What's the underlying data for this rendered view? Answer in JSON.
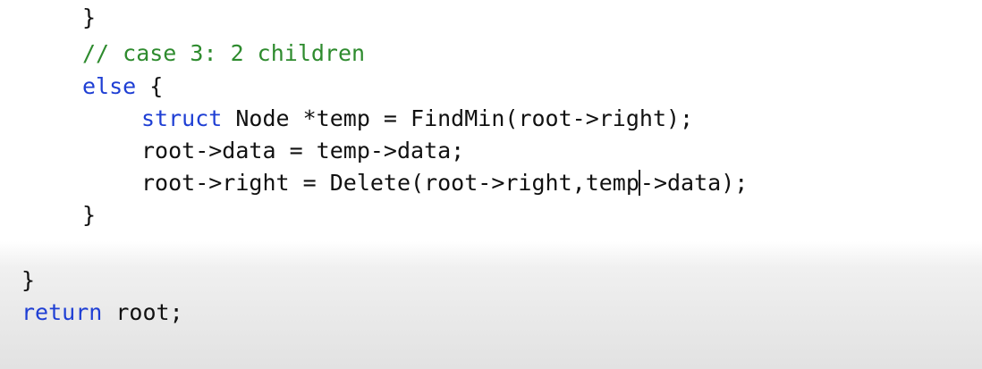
{
  "editor": {
    "lines": [
      {
        "id": "close-case2",
        "text": "}"
      },
      {
        "id": "comment-case3",
        "text": "// case 3: 2 children"
      },
      {
        "id": "else-line",
        "keyword": "else",
        "rest": " {"
      },
      {
        "id": "struct-line",
        "keyword": "struct",
        "rest": " Node *temp = FindMin(root->right);"
      },
      {
        "id": "data-line",
        "text": "root->data = temp->data;"
      },
      {
        "id": "delete-line-a",
        "text": "root->right = Delete(root->right,temp"
      },
      {
        "id": "delete-line-b",
        "text": "->data);"
      },
      {
        "id": "close-else",
        "text": "}"
      },
      {
        "id": "close-outer",
        "text": "}"
      },
      {
        "id": "return-line",
        "keyword": "return",
        "rest": " root;"
      }
    ]
  },
  "colors": {
    "keyword": "#1f3fd4",
    "comment": "#2e8b2e",
    "text": "#111111"
  }
}
